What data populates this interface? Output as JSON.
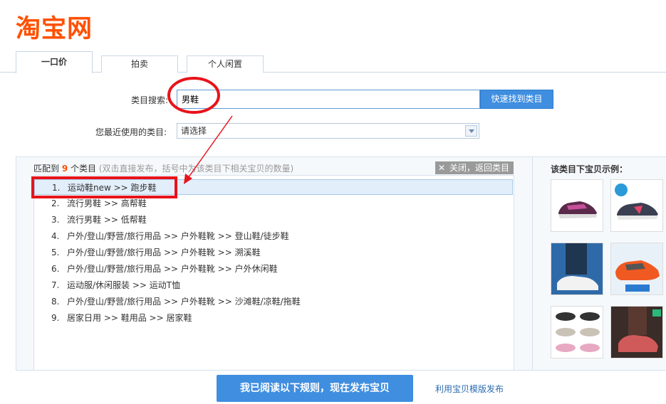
{
  "logo": "淘宝网",
  "tabs": [
    {
      "label": "一口价",
      "active": true
    },
    {
      "label": "拍卖",
      "active": false
    },
    {
      "label": "个人闲置",
      "active": false
    }
  ],
  "search": {
    "label": "类目搜索:",
    "value": "男鞋",
    "button": "快速找到类目"
  },
  "recent": {
    "label": "您最近使用的类目:",
    "selected": "请选择"
  },
  "results": {
    "prefix": "匹配到",
    "count": "9",
    "suffix": "个类目",
    "hint": "(双击直接发布，括号中为该类目下相关宝贝的数量)",
    "close": "关闭，返回类目",
    "items": [
      {
        "num": "1.",
        "path": "运动鞋new >> 跑步鞋"
      },
      {
        "num": "2.",
        "path": "流行男鞋 >> 高帮鞋"
      },
      {
        "num": "3.",
        "path": "流行男鞋 >> 低帮鞋"
      },
      {
        "num": "4.",
        "path": "户外/登山/野营/旅行用品 >> 户外鞋靴 >> 登山鞋/徒步鞋"
      },
      {
        "num": "5.",
        "path": "户外/登山/野营/旅行用品 >> 户外鞋靴 >> 溯溪鞋"
      },
      {
        "num": "6.",
        "path": "户外/登山/野营/旅行用品 >> 户外鞋靴 >> 户外休闲鞋"
      },
      {
        "num": "7.",
        "path": "运动服/休闲服装 >> 运动T恤"
      },
      {
        "num": "8.",
        "path": "户外/登山/野营/旅行用品 >> 户外鞋靴 >> 沙滩鞋/凉鞋/拖鞋"
      },
      {
        "num": "9.",
        "path": "居家日用 >> 鞋用品 >> 居家鞋"
      }
    ]
  },
  "sidebar": {
    "title": "该类目下宝贝示例："
  },
  "footer": {
    "publish": "我已阅读以下规则，现在发布宝贝",
    "template_link": "利用宝贝模版发布"
  },
  "colors": {
    "brand": "#ff5000",
    "accent": "#3f8ee0",
    "annotation": "#e8131b"
  }
}
